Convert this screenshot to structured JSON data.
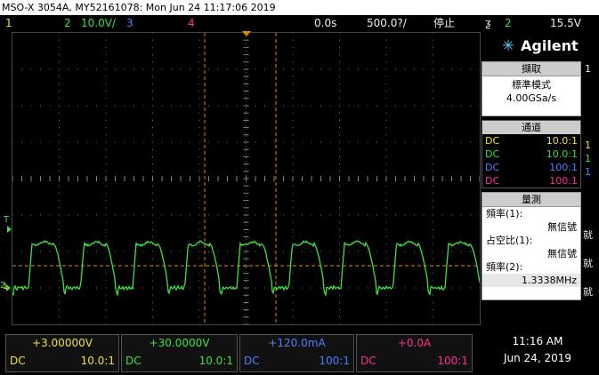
{
  "title_bar": {
    "text": "MSO-X 3054A, MY52161078: Mon Jun 24 11:17:06 2019"
  },
  "status": {
    "ch1_num": "1",
    "ch2_num": "2",
    "ch2_scale": "10.0V/",
    "ch3_num": "3",
    "ch4_num": "4",
    "time_delay": "0.0s",
    "time_base": "500.0?/",
    "run_state": "停止",
    "trig_edge": "ƺ",
    "trig_src": "2",
    "trig_level": "15.5V"
  },
  "brand": {
    "logo_text": "Agilent"
  },
  "acquisition": {
    "header": "擷取",
    "mode": "標準模式",
    "rate": "4.00GSa/s"
  },
  "channels_panel": {
    "header": "通道",
    "rows": [
      {
        "coupling": "DC",
        "probe": "10.0:1",
        "color": "#f0e040"
      },
      {
        "coupling": "DC",
        "probe": "10.0:1",
        "color": "#40e040"
      },
      {
        "coupling": "DC",
        "probe": "100:1",
        "color": "#5080ff"
      },
      {
        "coupling": "DC",
        "probe": "100:1",
        "color": "#ff3090"
      }
    ]
  },
  "measurements": {
    "header": "量測",
    "freq1_label": "頻率(1):",
    "freq1_value": "無信號",
    "duty1_label": "占空比(1):",
    "duty1_value": "無信號",
    "freq2_label": "頻率(2):",
    "freq2_value": "1.3338MHz"
  },
  "bottom_channels": [
    {
      "offset": "+3.00000V",
      "coupling": "DC",
      "probe": "10.0:1",
      "color": "#f0e040"
    },
    {
      "offset": "+30.0000V",
      "coupling": "DC",
      "probe": "10.0:1",
      "color": "#40e040"
    },
    {
      "offset": "+120.0mA",
      "coupling": "DC",
      "probe": "100:1",
      "color": "#5080ff"
    },
    {
      "offset": "+0.0A",
      "coupling": "DC",
      "probe": "100:1",
      "color": "#ff3090"
    }
  ],
  "clock": {
    "time": "11:16 AM",
    "date": "Jun 24, 2019"
  },
  "markers": {
    "trigger_marker": "T",
    "ch2_marker": "2",
    "ch1_marker": "1"
  },
  "side_tabs": [
    "1",
    "1",
    "1",
    "1",
    "就",
    "就",
    "就"
  ],
  "colors": {
    "ch1": "#f0e040",
    "ch2": "#40e040",
    "ch3": "#5080ff",
    "ch4": "#ff3090",
    "cursor": "#e08a00",
    "trigger_level": "#e08a00"
  }
}
